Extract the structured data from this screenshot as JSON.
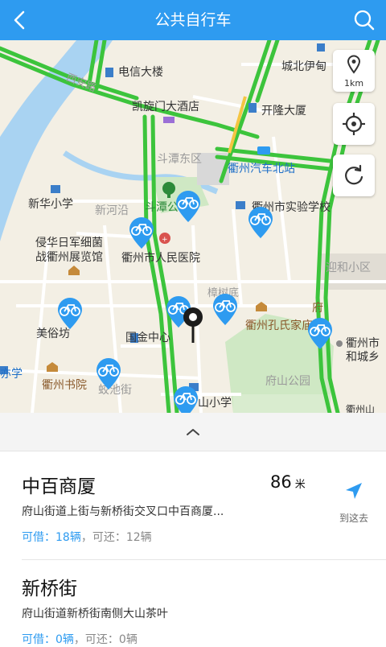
{
  "header": {
    "title": "公共自行车"
  },
  "map": {
    "scale_label": "1km",
    "labels": {
      "dianxin": "电信大楼",
      "chengbei": "城北伊甸",
      "kaixuanmen": "凯旋门大酒店",
      "kailong": "开隆大厦",
      "xianan": "西安路",
      "doutan": "斗潭东区",
      "bus_north": "衢州汽车北站",
      "xinhua_school": "新华小学",
      "xinhe": "新河沿",
      "doutan_park": "斗潭公",
      "shiyan_school": "衢州市实验学校",
      "qinhua": "侵华日军细菌",
      "qinhua2": "战衢州展览馆",
      "hospital": "衢州市人民医院",
      "yinghe": "迎和小区",
      "zhangshu": "樟树底",
      "fu": "府",
      "meisufang": "美俗坊",
      "guojin": "国金中心",
      "kongshi": "衢州孔氏家庙",
      "quzhou_shi": "衢州市",
      "hechengxiang": "和城乡",
      "xiaoxue_left": "亦学",
      "shuyuan": "衢州书院",
      "jiaochijie": "蛟池街",
      "fushan_park": "府山公园",
      "shan_school": "山小学",
      "bottom_right": "衢州山"
    }
  },
  "stations": [
    {
      "name": "中百商厦",
      "distance": "86",
      "distance_unit": "米",
      "address": "府山街道上街与新桥街交叉口中百商厦...",
      "borrow": "可借：18辆",
      "return": "，可还：12辆",
      "nav_label": "到这去"
    },
    {
      "name": "新桥街",
      "address": "府山街道新桥街南侧大山茶叶",
      "borrow": "可借：0辆",
      "return": "，可还：0辆"
    }
  ],
  "colors": {
    "header": "#2e9bf0",
    "road_green": "#3cc43c",
    "water": "#a9d3f2",
    "pin_blue": "#2e9bf0"
  }
}
